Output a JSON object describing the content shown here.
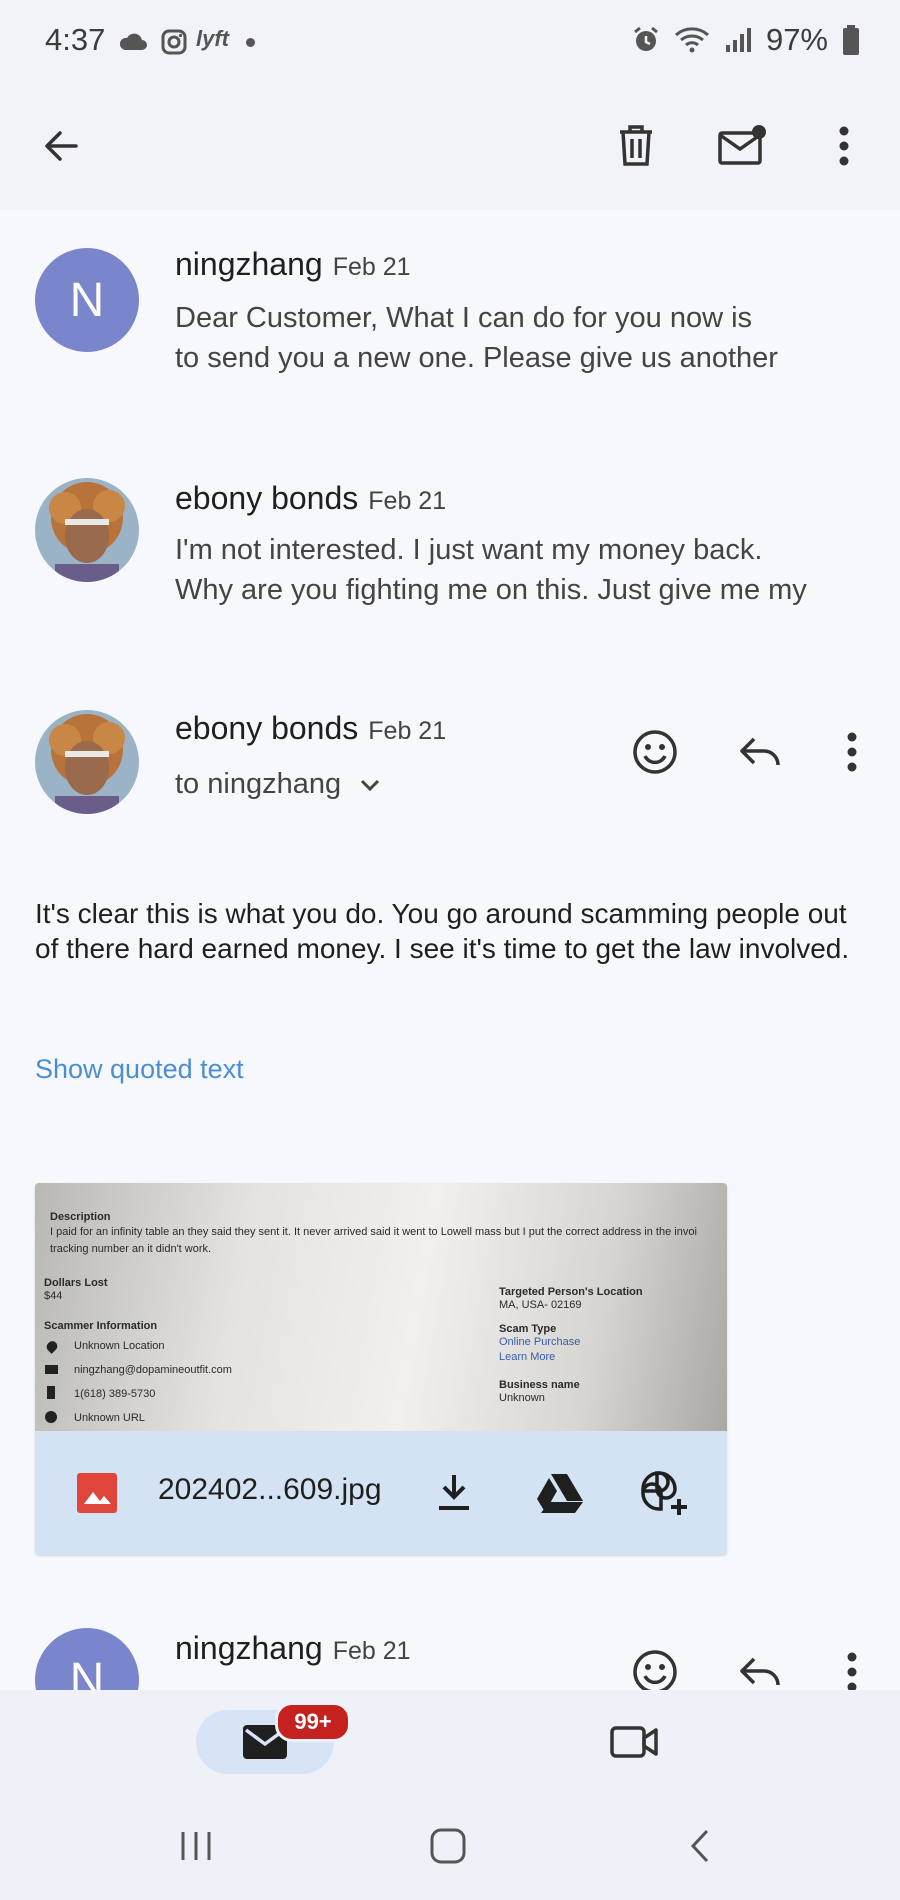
{
  "status_bar": {
    "time": "4:37",
    "left_icons": [
      "cloud-icon",
      "instagram-icon",
      "lyft-icon",
      "dot-icon"
    ],
    "lyft_text": "lyft",
    "right_icons": [
      "alarm-icon",
      "wifi-icon",
      "signal-icon",
      "battery-icon"
    ],
    "battery": "97%"
  },
  "toolbar": {
    "back": "back-arrow-icon",
    "actions": [
      "trash-icon",
      "mark-unread-icon",
      "more-vert-icon"
    ]
  },
  "messages": [
    {
      "avatar_letter": "N",
      "sender": "ningzhang",
      "date": "Feb 21",
      "snippet_line1": "Dear Customer, What I can do for you now is",
      "snippet_line2": "to send you a new one. Please give us another"
    },
    {
      "sender": "ebony bonds",
      "date": "Feb 21",
      "snippet_line1": "I'm not interested. I just want my money back.",
      "snippet_line2": "Why are you fighting me on this. Just give me my"
    }
  ],
  "expanded": {
    "sender": "ebony bonds",
    "date": "Feb 21",
    "to": "to ningzhang",
    "body": "It's clear this is what you do. You go around scamming people out of there hard earned money.  I see it's time to get the law involved.",
    "show_quoted": "Show quoted text",
    "attachment": {
      "filename": "202402...609.jpg",
      "preview": {
        "description_label": "Description",
        "description_line1": "I paid for an infinity table an they said they sent it. It never arrived said it went to Lowell mass but I put the correct address in the invoi",
        "description_line2": "tracking number an it didn't work.",
        "dollars_lost_label": "Dollars Lost",
        "dollars_lost": "$44",
        "scammer_info_label": "Scammer Information",
        "location": "Unknown Location",
        "email": "ningzhang@dopamineoutfit.com",
        "phone": "1(618) 389-5730",
        "url": "Unknown URL",
        "target_location_label": "Targeted Person's Location",
        "target_location": "MA, USA- 02169",
        "scam_type_label": "Scam Type",
        "scam_type": "Online Purchase",
        "learn_more": "Learn More",
        "business_label": "Business name",
        "business": "Unknown"
      }
    }
  },
  "next_message": {
    "avatar_letter": "N",
    "sender": "ningzhang",
    "date": "Feb 21"
  },
  "bottom_nav": {
    "mail_badge": "99+"
  },
  "colors": {
    "avatar_bg": "#7986cb",
    "link": "#4a8fd6",
    "badge": "#c5221f",
    "attachment_bar": "#d4e3f3"
  }
}
